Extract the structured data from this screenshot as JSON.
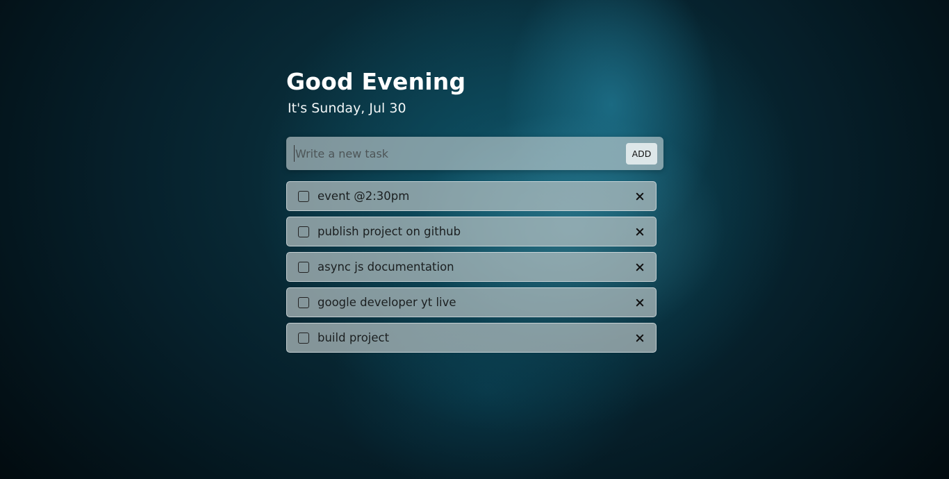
{
  "header": {
    "greeting": "Good Evening",
    "date_line": "It's Sunday, Jul 30"
  },
  "new_task": {
    "placeholder": "Write a new task",
    "value": "",
    "add_label": "ADD"
  },
  "tasks": [
    {
      "text": "event @2:30pm",
      "checked": false,
      "delete_icon": "close-icon"
    },
    {
      "text": "publish project on github",
      "checked": false,
      "delete_icon": "close-icon"
    },
    {
      "text": "async js documentation",
      "checked": false,
      "delete_icon": "close-icon"
    },
    {
      "text": "google developer yt live",
      "checked": false,
      "delete_icon": "close-icon"
    },
    {
      "text": "build project",
      "checked": false,
      "delete_icon": "close-icon"
    }
  ]
}
